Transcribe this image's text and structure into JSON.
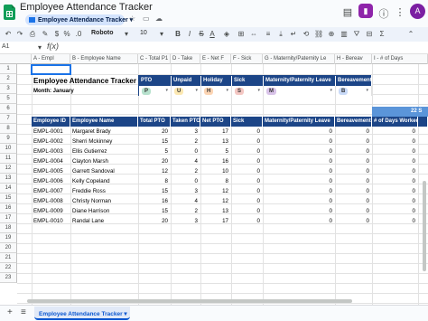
{
  "window": {
    "title": "Employee Attendance Tracker",
    "sheet_chip": "Employee Attendance Tracker"
  },
  "account": {
    "avatar_letter": "A"
  },
  "toolbar": {
    "font": "Roboto",
    "font_size": "10"
  },
  "formula_bar": {
    "cell_ref": "A1",
    "fx_label": "f(x)"
  },
  "column_headers": [
    "A - Empl",
    "B - Employee Name",
    "C - Total P1",
    "D - Take",
    "E - Net F",
    "F - Sick",
    "G - Maternity/Paternity Le",
    "H - Bereav",
    "I - # of Days"
  ],
  "row_numbers": [
    "1",
    "2",
    "3",
    "5",
    "6",
    "7",
    "8",
    "9",
    "10",
    "11",
    "12",
    "13",
    "14",
    "15",
    "16",
    "17",
    "18",
    "19",
    "20",
    "21",
    "22",
    "23"
  ],
  "sheet": {
    "title": "Employee Attendance Tracker",
    "month_label": "Month: January"
  },
  "legend": {
    "headers": [
      "PTO",
      "Unpaid",
      "Holiday",
      "Sick",
      "Maternity/Paternity Leave",
      "Bereavement"
    ],
    "codes": [
      "P",
      "U",
      "H",
      "S",
      "M",
      "B"
    ],
    "code_colors": [
      "#b7e1cd",
      "#fce8b2",
      "#fcd5b4",
      "#f4c7c3",
      "#d9c3e9",
      "#c9daf8"
    ]
  },
  "date_band": {
    "number": "22",
    "suffix": "S"
  },
  "table": {
    "headers": [
      "Employee ID",
      "Employee Name",
      "Total PTO",
      "Taken PTO",
      "Net PTO",
      "Sick",
      "Maternity/Paternity Leave",
      "Bereavement",
      "# of Days Worked"
    ],
    "rows": [
      [
        "EMPL-0001",
        "Margaret Brady",
        "20",
        "3",
        "17",
        "0",
        "0",
        "0",
        "0"
      ],
      [
        "EMPL-0002",
        "Sherri Mckinney",
        "15",
        "2",
        "13",
        "0",
        "0",
        "0",
        "0"
      ],
      [
        "EMPL-0003",
        "Ellis Gutierrez",
        "5",
        "0",
        "5",
        "0",
        "0",
        "0",
        "0"
      ],
      [
        "EMPL-0004",
        "Clayton Marsh",
        "20",
        "4",
        "16",
        "0",
        "0",
        "0",
        "0"
      ],
      [
        "EMPL-0005",
        "Garrett Sandoval",
        "12",
        "2",
        "10",
        "0",
        "0",
        "0",
        "0"
      ],
      [
        "EMPL-0006",
        "Kelly Copeland",
        "8",
        "0",
        "8",
        "0",
        "0",
        "0",
        "0"
      ],
      [
        "EMPL-0007",
        "Freddie Ross",
        "15",
        "3",
        "12",
        "0",
        "0",
        "0",
        "0"
      ],
      [
        "EMPL-0008",
        "Christy Norman",
        "16",
        "4",
        "12",
        "0",
        "0",
        "0",
        "0"
      ],
      [
        "EMPL-0009",
        "Diane Harrison",
        "15",
        "2",
        "13",
        "0",
        "0",
        "0",
        "0"
      ],
      [
        "EMPL-0010",
        "Randal Lane",
        "20",
        "3",
        "17",
        "0",
        "0",
        "0",
        "0"
      ]
    ]
  },
  "bottom": {
    "add_sheet_icon": "plus-icon",
    "all_sheets_icon": "menu-icon",
    "active_tab": "Employee Attendance Tracker"
  },
  "colors": {
    "header_navy": "#1c4587",
    "date_blue": "#5b95d9",
    "accent_purple": "#8e24aa"
  }
}
